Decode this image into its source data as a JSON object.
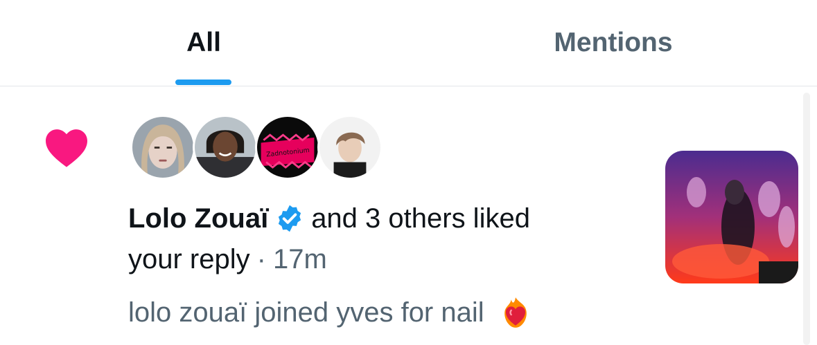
{
  "tabs": {
    "all_label": "All",
    "mentions_label": "Mentions",
    "active": "All"
  },
  "notification": {
    "type_icon": "heart-icon",
    "avatars": [
      "avatar-1",
      "avatar-2",
      "avatar-3",
      "avatar-4"
    ],
    "avatar3_text": "Zadnotonium",
    "name": "Lolo Zouaï",
    "verified": true,
    "action_text": "and 3 others liked",
    "action_text_2": "your reply",
    "separator": "·",
    "time": "17m",
    "preview_text": "lolo zouaï joined yves for nail",
    "preview_emoji": "heart-on-fire"
  },
  "colors": {
    "accent": "#1d9bf0",
    "like": "#f91880",
    "text_primary": "#0f1419",
    "text_secondary": "#536471"
  }
}
